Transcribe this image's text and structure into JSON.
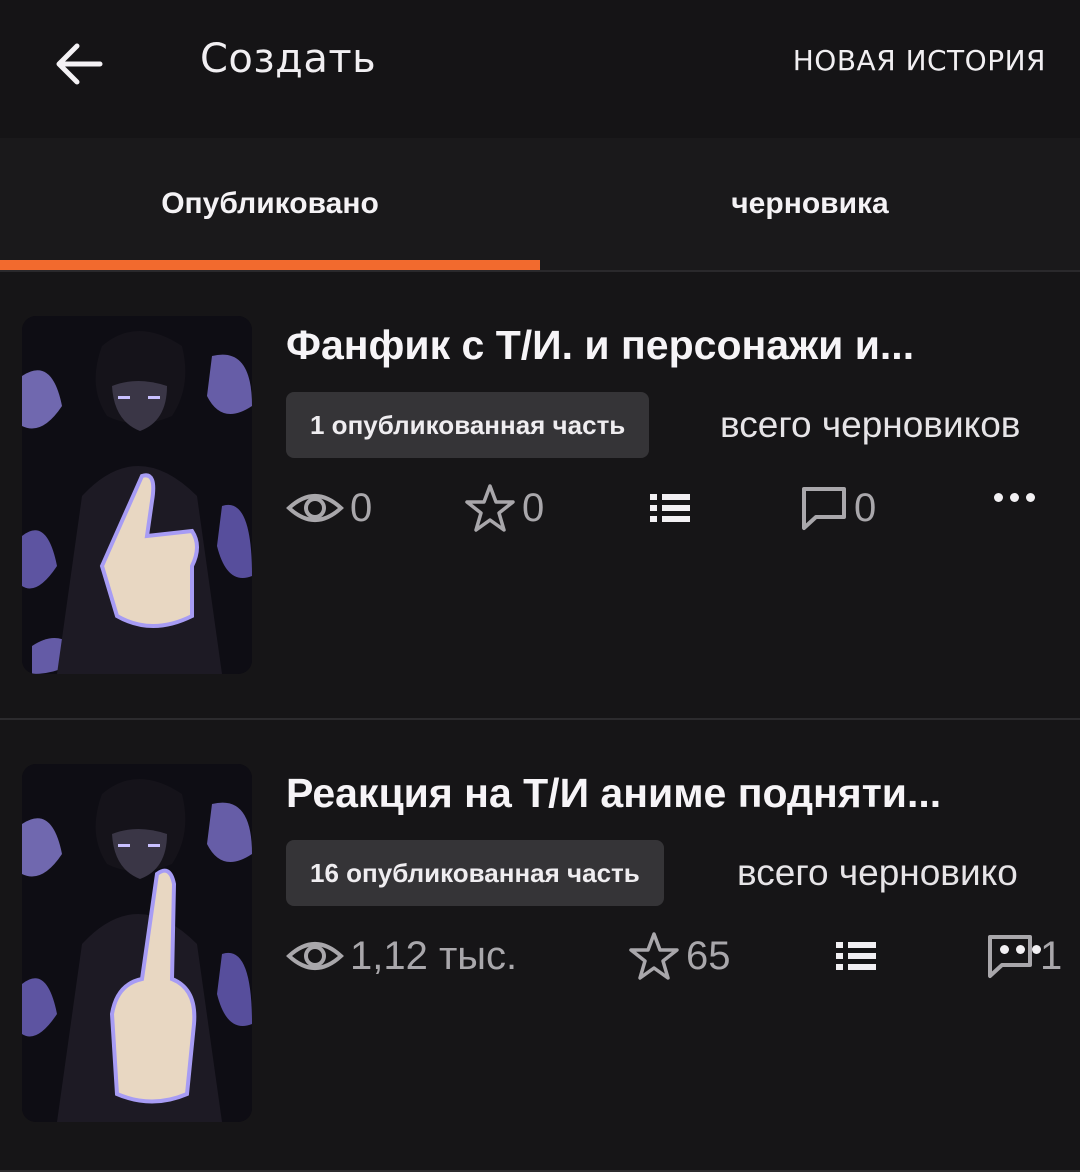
{
  "header": {
    "back_icon": "arrow-left-icon",
    "title": "Создать",
    "new_story_label": "НОВАЯ ИСТОРИЯ"
  },
  "tabs": [
    {
      "label": "Опубликовано",
      "active": true
    },
    {
      "label": "черновика",
      "active": false
    }
  ],
  "colors": {
    "accent": "#f26a2e",
    "background": "#121113",
    "badge": "#353437"
  },
  "stories": [
    {
      "title": "Фанфик с Т/И.   и персонажи и...",
      "published_badge": "1 опубликованная часть",
      "drafts_text": "всего черновиков",
      "views": "0",
      "votes": "0",
      "comments": "0",
      "icons": [
        "eye-icon",
        "star-icon",
        "list-icon",
        "comment-icon",
        "more-icon"
      ]
    },
    {
      "title": "Реакция на Т/И аниме подняти...",
      "published_badge": "16 опубликованная часть",
      "drafts_text": "всего черновико",
      "views": "1,12 тыс.",
      "votes": "65",
      "comments": "1",
      "icons": [
        "eye-icon",
        "star-icon",
        "list-icon",
        "comment-icon",
        "more-icon"
      ]
    }
  ]
}
